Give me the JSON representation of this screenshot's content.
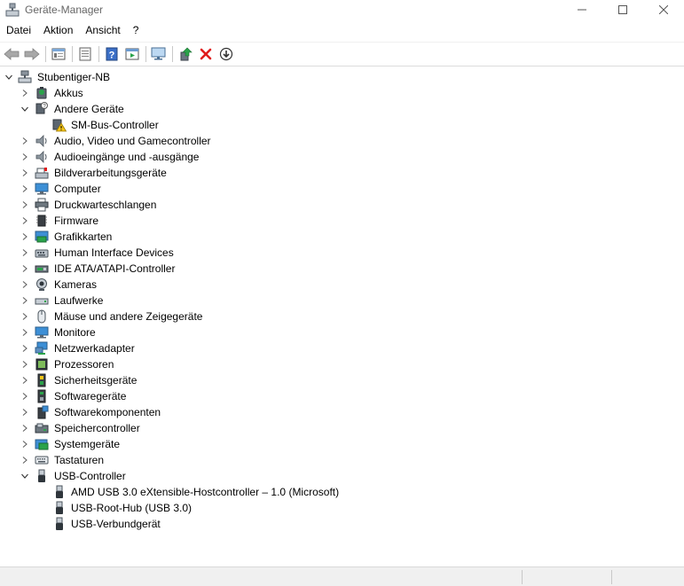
{
  "window": {
    "title": "Geräte-Manager"
  },
  "menu": [
    "Datei",
    "Aktion",
    "Ansicht",
    "?"
  ],
  "toolbar": {
    "buttons": [
      "back-icon",
      "forward-icon",
      "properties-icon",
      "view-icon",
      "help-icon",
      "action-icon",
      "monitor-scan-icon",
      "update-driver-icon",
      "uninstall-icon",
      "download-icon"
    ]
  },
  "tree": {
    "root": "Stubentiger-NB",
    "items": [
      {
        "label": "Akkus",
        "icon": "battery-icon",
        "expanded": false
      },
      {
        "label": "Andere Geräte",
        "icon": "other-devices-icon",
        "expanded": true,
        "children": [
          {
            "label": "SM-Bus-Controller",
            "icon": "warning-device-icon"
          }
        ]
      },
      {
        "label": "Audio, Video und Gamecontroller",
        "icon": "speaker-icon",
        "expanded": false
      },
      {
        "label": "Audioeingänge und -ausgänge",
        "icon": "speaker-icon",
        "expanded": false
      },
      {
        "label": "Bildverarbeitungsgeräte",
        "icon": "scanner-icon",
        "expanded": false
      },
      {
        "label": "Computer",
        "icon": "computer-icon",
        "expanded": false
      },
      {
        "label": "Druckwarteschlangen",
        "icon": "printer-icon",
        "expanded": false
      },
      {
        "label": "Firmware",
        "icon": "chip-icon",
        "expanded": false
      },
      {
        "label": "Grafikkarten",
        "icon": "display-adapter-icon",
        "expanded": false
      },
      {
        "label": "Human Interface Devices",
        "icon": "hid-icon",
        "expanded": false
      },
      {
        "label": "IDE ATA/ATAPI-Controller",
        "icon": "ide-icon",
        "expanded": false
      },
      {
        "label": "Kameras",
        "icon": "camera-icon",
        "expanded": false
      },
      {
        "label": "Laufwerke",
        "icon": "drive-icon",
        "expanded": false
      },
      {
        "label": "Mäuse und andere Zeigegeräte",
        "icon": "mouse-icon",
        "expanded": false
      },
      {
        "label": "Monitore",
        "icon": "monitor-icon",
        "expanded": false
      },
      {
        "label": "Netzwerkadapter",
        "icon": "network-icon",
        "expanded": false
      },
      {
        "label": "Prozessoren",
        "icon": "processor-icon",
        "expanded": false
      },
      {
        "label": "Sicherheitsgeräte",
        "icon": "security-icon",
        "expanded": false
      },
      {
        "label": "Softwaregeräte",
        "icon": "software-device-icon",
        "expanded": false
      },
      {
        "label": "Softwarekomponenten",
        "icon": "software-component-icon",
        "expanded": false
      },
      {
        "label": "Speichercontroller",
        "icon": "storage-controller-icon",
        "expanded": false
      },
      {
        "label": "Systemgeräte",
        "icon": "system-device-icon",
        "expanded": false
      },
      {
        "label": "Tastaturen",
        "icon": "keyboard-icon",
        "expanded": false
      },
      {
        "label": "USB-Controller",
        "icon": "usb-icon",
        "expanded": true,
        "children": [
          {
            "label": "AMD USB 3.0 eXtensible-Hostcontroller – 1.0 (Microsoft)",
            "icon": "usb-icon"
          },
          {
            "label": "USB-Root-Hub (USB 3.0)",
            "icon": "usb-icon"
          },
          {
            "label": "USB-Verbundgerät",
            "icon": "usb-icon"
          }
        ]
      }
    ]
  },
  "colors": {
    "accent_blue": "#2f7bd1",
    "warning_yellow": "#f5c518",
    "error_red": "#e01b1b",
    "green": "#2aa34a"
  }
}
